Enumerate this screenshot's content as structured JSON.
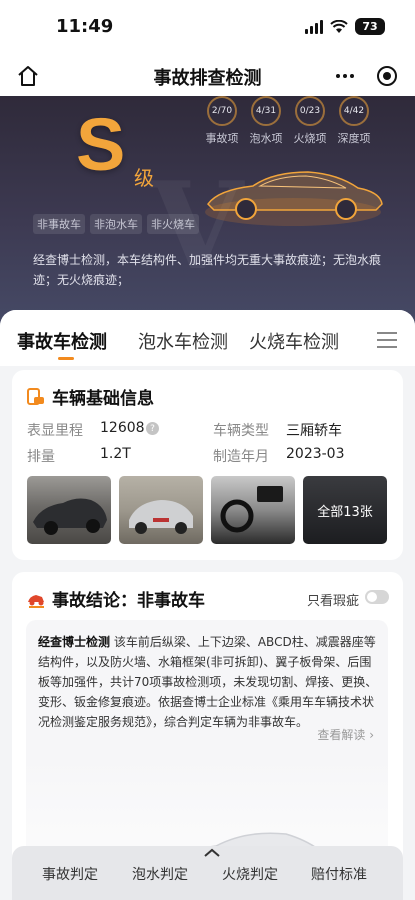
{
  "status": {
    "time": "11:49",
    "battery": "73"
  },
  "nav": {
    "title": "事故排查检测"
  },
  "hero": {
    "grade": "S",
    "grade_unit": "级",
    "stats": [
      {
        "value": "2/70",
        "label": "事故项"
      },
      {
        "value": "4/31",
        "label": "泡水项"
      },
      {
        "value": "0/23",
        "label": "火烧项"
      },
      {
        "value": "4/42",
        "label": "深度项"
      }
    ],
    "tags": [
      "非事故车",
      "非泡水车",
      "非火烧车"
    ],
    "description": "经查博士检测，本车结构件、加强件均无重大事故痕迹；无泡水痕迹；无火烧痕迹；"
  },
  "tabs": [
    {
      "label": "事故车检测",
      "active": true
    },
    {
      "label": "泡水车检测",
      "active": false
    },
    {
      "label": "火烧车检测",
      "active": false
    }
  ],
  "vehicle": {
    "title": "车辆基础信息",
    "mileage_label": "表显里程",
    "mileage_value": "12608",
    "type_label": "车辆类型",
    "type_value": "三厢轿车",
    "displacement_label": "排量",
    "displacement_value": "1.2T",
    "year_label": "制造年月",
    "year_value": "2023-03",
    "photos_more": "全部13张"
  },
  "conclusion": {
    "title": "事故结论：非事故车",
    "toggle_label": "只看瑕疵",
    "brand": "经查博士检测",
    "text": "该车前后纵梁、上下边梁、ABCD柱、减震器座等结构件，以及防火墙、水箱框架(非可拆卸)、翼子板骨架、后围板等加强件，共计70项事故检测项，未发现切割、焊接、更换、变形、钣金修复痕迹。依据查博士企业标准《乘用车车辆技术状况检测鉴定服务规范》，综合判定车辆为非事故车。",
    "detail_link": "查看解读 ›"
  },
  "bottom_nav": [
    "事故判定",
    "泡水判定",
    "火烧判定",
    "赔付标准"
  ],
  "colors": {
    "accent": "#f28a1e",
    "grade": "#f2a53b",
    "hero_bg": "#3d3a52"
  }
}
